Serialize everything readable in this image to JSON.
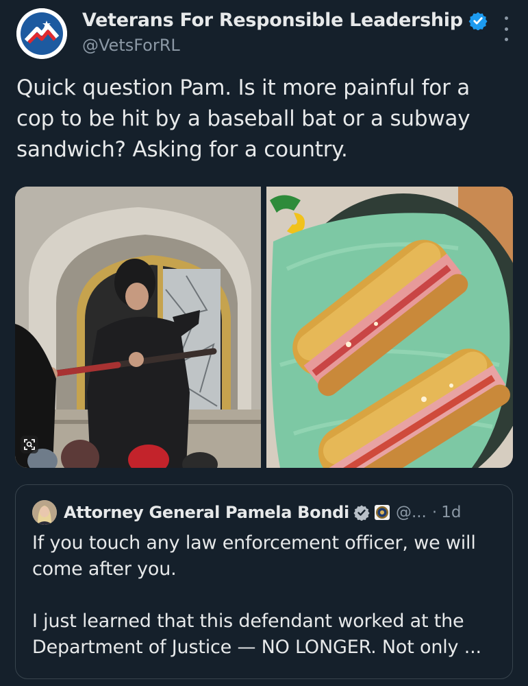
{
  "author": {
    "display_name": "Veterans For Responsible Leadership",
    "handle": "@VetsForRL",
    "verified_icon": "verified-badge-icon",
    "brand_colors": {
      "red": "#e0292f",
      "blue": "#1d5aa0",
      "badge_blue": "#1d9bf0"
    }
  },
  "tweet": {
    "text": "Quick question Pam. Is it more painful for a cop to be hit by a baseball bat or a subway sandwich? Asking for a country."
  },
  "media": {
    "left_image_icon": "scan-search-icon",
    "right_image_icon": "subway-logo-icon"
  },
  "quoted_tweet": {
    "display_name": "Attorney General Pamela Bondi",
    "handle": "@...",
    "separator": "·",
    "time": "1d",
    "paragraphs": [
      "If you touch any law enforcement officer, we will come after you.",
      "I just learned that this defendant worked at the Department of Justice — NO LONGER. Not only ..."
    ]
  },
  "theme": {
    "background": "#15202b",
    "text": "#e7e9ea",
    "muted": "#8b98a5",
    "border": "#38444d"
  }
}
